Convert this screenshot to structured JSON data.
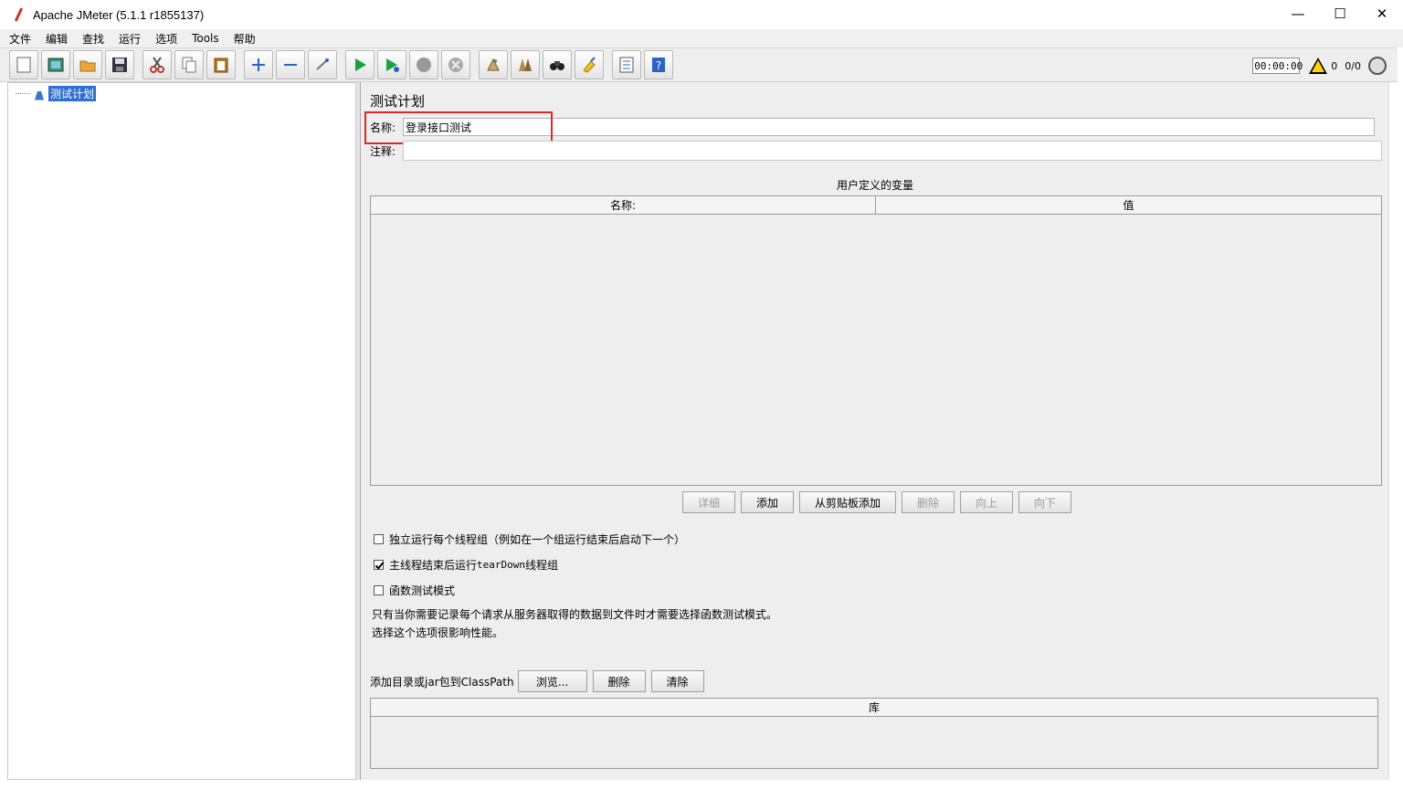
{
  "window": {
    "title": "Apache JMeter (5.1.1 r1855137)",
    "minimize": "—",
    "maximize": "☐",
    "close": "✕"
  },
  "menu": [
    "文件",
    "编辑",
    "查找",
    "运行",
    "选项",
    "Tools",
    "帮助"
  ],
  "toolbar": {
    "buttons": [
      {
        "name": "new-icon"
      },
      {
        "name": "templates-icon"
      },
      {
        "name": "open-icon"
      },
      {
        "name": "save-icon"
      },
      {
        "name": "cut-icon"
      },
      {
        "name": "copy-icon"
      },
      {
        "name": "paste-icon"
      },
      {
        "name": "expand-icon"
      },
      {
        "name": "collapse-icon"
      },
      {
        "name": "toggle-icon"
      },
      {
        "name": "start-icon"
      },
      {
        "name": "start-no-pause-icon"
      },
      {
        "name": "stop-icon"
      },
      {
        "name": "shutdown-icon"
      },
      {
        "name": "clear-icon"
      },
      {
        "name": "clear-all-icon"
      },
      {
        "name": "search-icon"
      },
      {
        "name": "reset-search-icon"
      },
      {
        "name": "function-helper-icon"
      },
      {
        "name": "help-icon"
      }
    ],
    "timer": "00:00:00",
    "warnings": "0",
    "threads": "0/0"
  },
  "tree": {
    "root_label": "测试计划"
  },
  "panel": {
    "title": "测试计划",
    "name_label": "名称:",
    "name_value": "登录接口测试",
    "comment_label": "注释:",
    "vars_title": "用户定义的变量",
    "vars_columns": [
      "名称:",
      "值"
    ],
    "buttons": [
      {
        "label": "详细",
        "enabled": false
      },
      {
        "label": "添加",
        "enabled": true
      },
      {
        "label": "从剪贴板添加",
        "enabled": true
      },
      {
        "label": "删除",
        "enabled": false
      },
      {
        "label": "向上",
        "enabled": false
      },
      {
        "label": "向下",
        "enabled": false
      }
    ],
    "options": [
      {
        "label": "独立运行每个线程组（例如在一个组运行结束后启动下一个）",
        "checked": false
      },
      {
        "label_pre": "主线程结束后运行 ",
        "label_mono": "tearDown",
        "label_post": "线程组",
        "checked": true
      },
      {
        "label": "函数测试模式",
        "checked": false
      }
    ],
    "note_line1": "只有当你需要记录每个请求从服务器取得的数据到文件时才需要选择函数测试模式。",
    "note_line2": "选择这个选项很影响性能。",
    "classpath_label": "添加目录或jar包到ClassPath",
    "browse_label": "浏览...",
    "delete_label": "删除",
    "clear_label": "清除",
    "library_column": "库"
  }
}
